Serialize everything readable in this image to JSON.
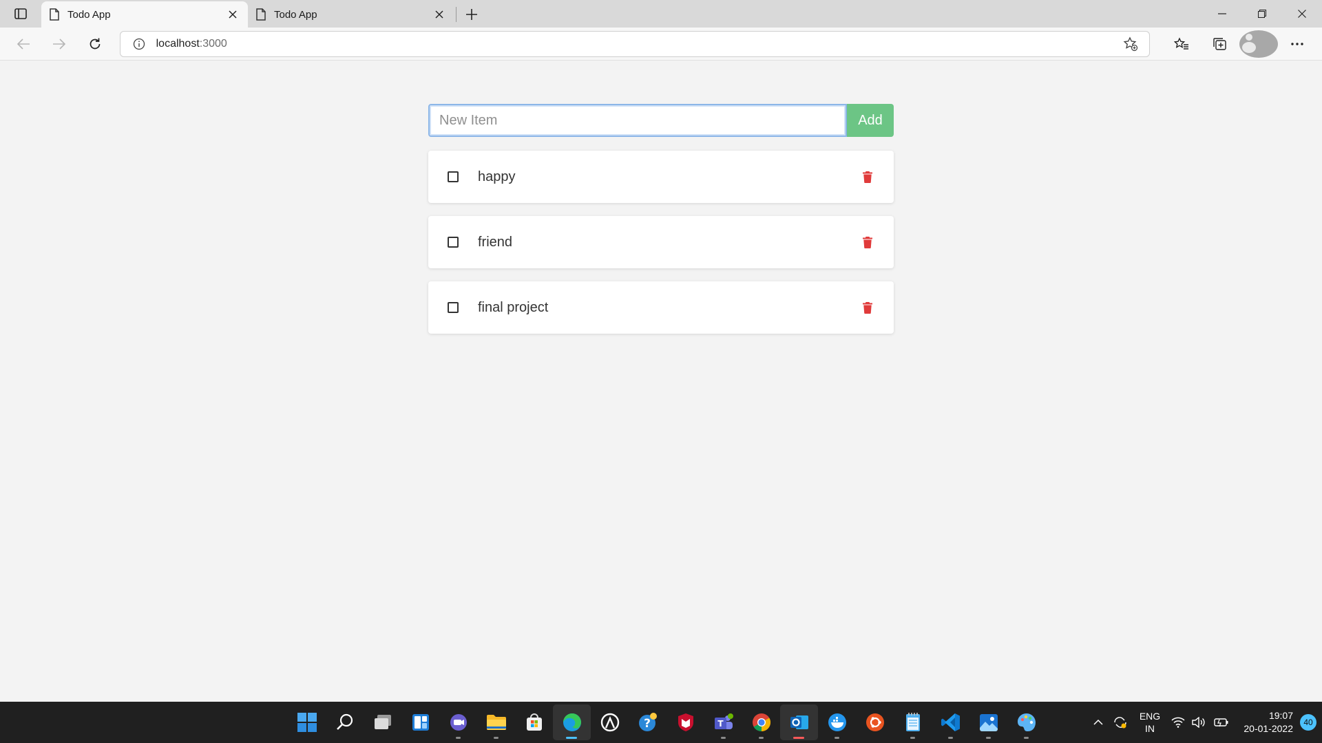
{
  "browser": {
    "tabs": [
      {
        "title": "Todo App",
        "active": true
      },
      {
        "title": "Todo App",
        "active": false
      }
    ],
    "address": {
      "host": "localhost",
      "port": ":3000"
    }
  },
  "todo": {
    "input_placeholder": "New Item",
    "input_value": "",
    "add_label": "Add",
    "items": [
      {
        "text": "happy",
        "done": false
      },
      {
        "text": "friend",
        "done": false
      },
      {
        "text": "final project",
        "done": false
      }
    ],
    "colors": {
      "add_button": "#6cc585",
      "trash": "#e03b3b",
      "input_focus": "#8cb6e8"
    }
  },
  "taskbar": {
    "apps": [
      "start-icon",
      "search-icon",
      "task-view-icon",
      "widgets-icon",
      "chat-icon",
      "file-explorer-icon",
      "store-icon",
      "edge-icon",
      "app-icon",
      "help-icon",
      "mcafee-icon",
      "teams-icon",
      "chrome-icon",
      "outlook-icon",
      "docker-icon",
      "ubuntu-icon",
      "notepad-icon",
      "vscode-icon",
      "photos-icon",
      "paint-icon"
    ],
    "language": {
      "line1": "ENG",
      "line2": "IN"
    },
    "time": "19:07",
    "date": "20-01-2022",
    "notifications": "40"
  }
}
